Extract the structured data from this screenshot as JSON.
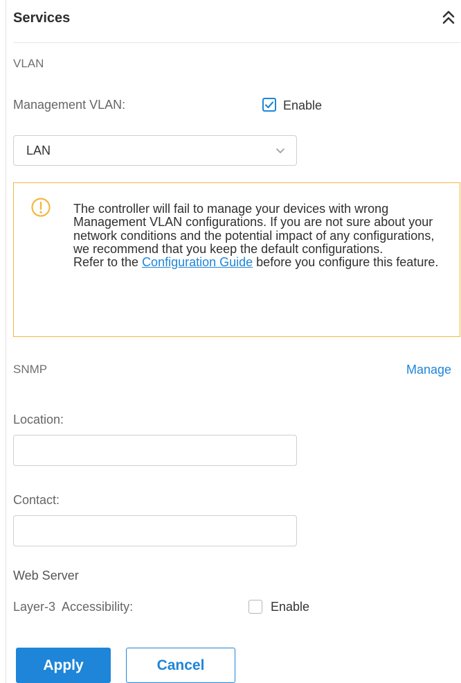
{
  "header": {
    "title": "Services"
  },
  "vlan": {
    "section_title": "VLAN",
    "management_label": "Management VLAN:",
    "enable_label": "Enable",
    "enabled": true,
    "selected_network": "LAN"
  },
  "notice": {
    "line1": "The controller will fail to manage your devices with wrong Management VLAN configurations. If you are not sure about your network conditions and the potential impact of any configurations, we recommend that you keep the default configurations.",
    "line2_prefix": "Refer to the ",
    "link_text": "Configuration Guide",
    "line2_suffix": " before you configure this feature."
  },
  "snmp": {
    "section_title": "SNMP",
    "manage_link": "Manage",
    "location_label": "Location:",
    "location_value": "",
    "contact_label": "Contact:",
    "contact_value": ""
  },
  "web_server": {
    "section_title": "Web Server",
    "accessibility_label": "Layer-3  Accessibility:",
    "enable_label": "Enable",
    "enabled": false
  },
  "buttons": {
    "apply": "Apply",
    "cancel": "Cancel"
  },
  "colors": {
    "accent": "#1e85d8",
    "warning": "#f2b83f"
  }
}
